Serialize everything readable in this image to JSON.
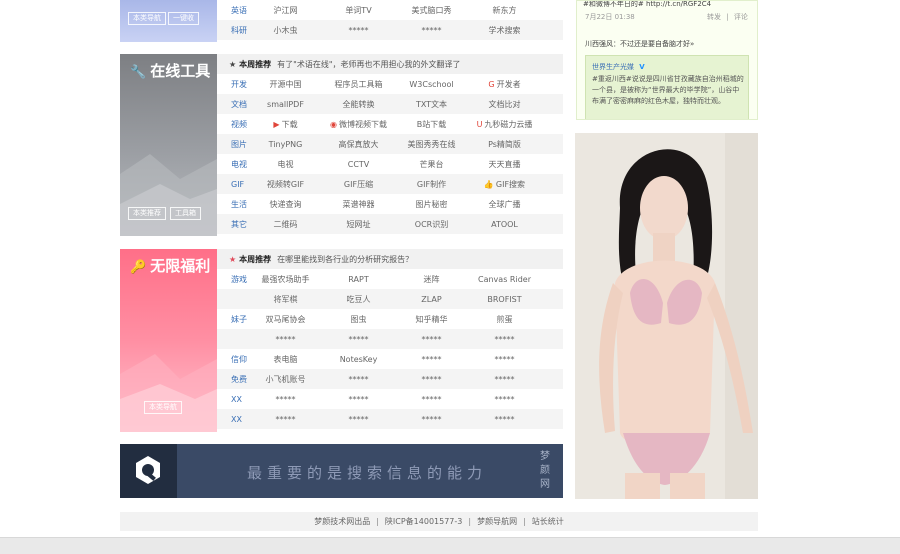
{
  "top_section": {
    "side_buttons": [
      "本类导航",
      "一键收"
    ],
    "rows": [
      {
        "cat": "英语",
        "cells": [
          "沪江网",
          "单词TV",
          "美式脑口秀",
          "新东方"
        ]
      },
      {
        "cat": "科研",
        "cells": [
          "小木虫",
          "*****",
          "*****",
          "学术搜索"
        ]
      }
    ]
  },
  "tools": {
    "title": "在线工具",
    "side_buttons": [
      "本类推荐",
      "工具箱"
    ],
    "recommend_label": "本周推荐",
    "recommend_text": "有了\"术语在线\"，老师再也不用担心我的外文翻译了",
    "rows": [
      {
        "cat": "开发",
        "cells": [
          "开源中国",
          "程序员工具箱",
          "W3Cschool",
          "开发者"
        ],
        "icons": [
          "",
          "",
          "",
          "G"
        ]
      },
      {
        "cat": "文档",
        "cells": [
          "smallPDF",
          "全能转换",
          "TXT文本",
          "文档比对"
        ],
        "icons": [
          "",
          "",
          "",
          ""
        ]
      },
      {
        "cat": "视频",
        "cells": [
          "下载",
          "微博视频下载",
          "B站下载",
          "九秒磁力云播"
        ],
        "icons": [
          "▶",
          "◉",
          "",
          "U"
        ]
      },
      {
        "cat": "图片",
        "cells": [
          "TinyPNG",
          "高保真放大",
          "美图秀秀在线",
          "Ps精简版"
        ],
        "icons": [
          "",
          "",
          "",
          ""
        ]
      },
      {
        "cat": "电视",
        "cells": [
          "电视",
          "CCTV",
          "芒果台",
          "天天直播"
        ],
        "icons": [
          "",
          "",
          "",
          ""
        ]
      },
      {
        "cat": "GIF",
        "cells": [
          "视频转GIF",
          "GIF压缩",
          "GIF制作",
          "GIF搜索"
        ],
        "icons": [
          "",
          "",
          "",
          "👍"
        ]
      },
      {
        "cat": "生活",
        "cells": [
          "快递查询",
          "菜谱神器",
          "图片秘密",
          "全球广播"
        ],
        "icons": [
          "",
          "",
          "",
          ""
        ]
      },
      {
        "cat": "其它",
        "cells": [
          "二维码",
          "短网址",
          "OCR识别",
          "ATOOL"
        ],
        "icons": [
          "",
          "",
          "",
          ""
        ]
      }
    ]
  },
  "welfare": {
    "title": "无限福利",
    "side_button": "本类导航",
    "recommend_label": "本周推荐",
    "recommend_text": "在哪里能找到各行业的分析研究报告？",
    "rows": [
      {
        "cat": "游戏",
        "cells": [
          "最强农场助手",
          "RAPT",
          "迷阵",
          "Canvas Rider"
        ],
        "icons": [
          "",
          "",
          "",
          ""
        ]
      },
      {
        "cat": "",
        "cells": [
          "将军棋",
          "吃豆人",
          "ZLAP",
          "BROFIST"
        ],
        "icons": [
          "",
          "",
          "",
          ""
        ]
      },
      {
        "cat": "妹子",
        "cells": [
          "双马尾协会",
          "图虫",
          "知乎精华",
          "煎蛋"
        ],
        "icons": [
          "",
          "",
          "",
          ""
        ]
      },
      {
        "cat": "",
        "cells": [
          "*****",
          "*****",
          "*****",
          "*****"
        ],
        "icons": [
          "",
          "",
          "",
          ""
        ]
      },
      {
        "cat": "信仰",
        "cells": [
          "表电脑",
          "NotesKey",
          "*****",
          "*****"
        ],
        "icons": [
          "",
          "",
          "",
          ""
        ]
      },
      {
        "cat": "免费",
        "cells": [
          "小飞机账号",
          "*****",
          "*****",
          "*****"
        ],
        "icons": [
          "",
          "",
          "",
          ""
        ]
      },
      {
        "cat": "XX",
        "cells": [
          "*****",
          "*****",
          "*****",
          "*****"
        ],
        "icons": [
          "",
          "",
          "",
          ""
        ]
      },
      {
        "cat": "XX",
        "cells": [
          "*****",
          "*****",
          "*****",
          "*****"
        ],
        "icons": [
          "",
          "",
          "",
          ""
        ]
      }
    ]
  },
  "banner": {
    "slogan": "最重要的是搜索信息的能力",
    "seal": "梦颜网"
  },
  "weibo": {
    "line1": "#和微博不年日的#  http://t.cn/RGF2C4",
    "date": "7月22日 01:38",
    "actions": [
      "转发",
      "评论"
    ],
    "quote": "川西强风：不过还是要自备脑才好»",
    "card_user": "世界生产光媒",
    "card_text": "#重返川西#说说是四川省甘孜藏族自治州稻城的一个县，是被称为“世界最大的毕学院”，山谷中布满了密密麻麻的红色木屋，独特而壮观。"
  },
  "footer": {
    "items": [
      "梦颜技术网出品",
      "陕ICP备14001577-3",
      "梦颜导航网",
      "站长统计"
    ]
  },
  "colors": {
    "tools_accent": "#8e9196",
    "welfare_accent": "#ff7a90",
    "banner_bg": "#3a4a66",
    "category_link": "#3a6fb5"
  }
}
